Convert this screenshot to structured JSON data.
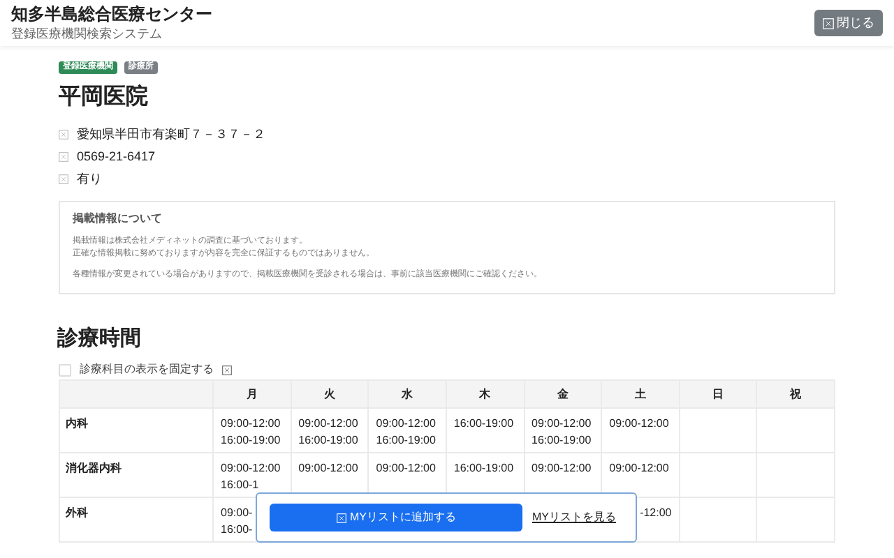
{
  "header": {
    "title": "知多半島総合医療センター",
    "subtitle": "登録医療機関検索システム",
    "close_button": "閉じる"
  },
  "badges": [
    {
      "label": "登録医療機関",
      "color": "#2e8b57"
    },
    {
      "label": "診療所",
      "color": "#7a7f85"
    }
  ],
  "clinic_name": "平岡医院",
  "details": [
    "愛知県半田市有楽町７－３７－２",
    "0569-21-6417",
    "有り"
  ],
  "notice": {
    "title": "掲載情報について",
    "paragraphs": [
      [
        "掲載情報は株式会社メディネットの調査に基づいております。",
        "正確な情報掲載に努めておりますが内容を完全に保証するものではありません。"
      ],
      [
        "各種情報が変更されている場合がありますので、掲載医療機関を受診される場合は、事前に該当医療機関にご確認ください。"
      ]
    ]
  },
  "hours": {
    "title": "診療時間",
    "fix_checkbox": {
      "label": "診療科目の表示を固定する",
      "checked": false
    },
    "columns": [
      "月",
      "火",
      "水",
      "木",
      "金",
      "土",
      "日",
      "祝"
    ],
    "rows": [
      {
        "department": "内科",
        "cells": [
          [
            "09:00-12:00",
            "16:00-19:00"
          ],
          [
            "09:00-12:00",
            "16:00-19:00"
          ],
          [
            "09:00-12:00",
            "16:00-19:00"
          ],
          [
            "16:00-19:00"
          ],
          [
            "09:00-12:00",
            "16:00-19:00"
          ],
          [
            "09:00-12:00"
          ],
          [],
          []
        ]
      },
      {
        "department": "消化器内科",
        "cells": [
          [
            "09:00-12:00",
            "16:00-1"
          ],
          [
            "09:00-12:00"
          ],
          [
            "09:00-12:00"
          ],
          [
            "16:00-19:00"
          ],
          [
            "09:00-12:00"
          ],
          [
            "09:00-12:00"
          ],
          [],
          []
        ]
      },
      {
        "department": "外科",
        "cells": [
          [
            "09:00-",
            "16:00-"
          ],
          [],
          [],
          [],
          [],
          {
            "lines": [
              "-12:00"
            ],
            "clipped_left": true
          },
          [],
          []
        ]
      }
    ]
  },
  "mylist_popup": {
    "add_button": "MYリストに追加する",
    "view_link": "MYリストを見る"
  }
}
